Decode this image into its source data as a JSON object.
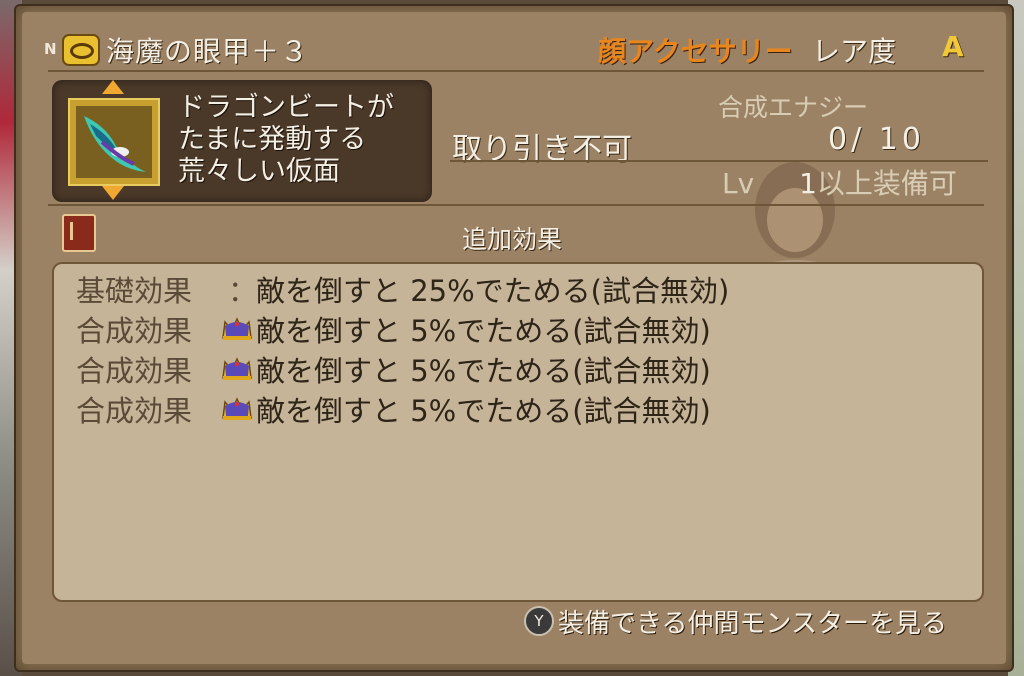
{
  "title_row": {
    "rank_tag": "N",
    "item_name": "海魔の眼甲＋３",
    "category": "顔アクセサリー",
    "rarity_label": "レア度",
    "rarity_value": "A"
  },
  "item": {
    "icon": "mask-icon",
    "description": [
      "ドラゴンビートが",
      "たまに発動する",
      "荒々しい仮面"
    ]
  },
  "info": {
    "energy_label": "合成エナジー",
    "trade_status": "取り引き不可",
    "energy_value": "0/ 10",
    "level_prefix": "Lv",
    "level_value": "1",
    "level_suffix": "以上装備可"
  },
  "effects": {
    "header": "追加効果",
    "rows": [
      {
        "label": "基礎効果",
        "sep": "：",
        "icon": "none",
        "text": "敵を倒すと 25%でためる(試合無効)"
      },
      {
        "label": "合成効果",
        "sep": "",
        "icon": "crown-icon",
        "text": "敵を倒すと 5%でためる(試合無効)"
      },
      {
        "label": "合成効果",
        "sep": "",
        "icon": "crown-icon",
        "text": "敵を倒すと 5%でためる(試合無効)"
      },
      {
        "label": "合成効果",
        "sep": "",
        "icon": "crown-icon",
        "text": "敵を倒すと 5%でためる(試合無効)"
      }
    ]
  },
  "footer": {
    "button_glyph": "Y",
    "text": "装備できる仲間モンスターを見る"
  },
  "colors": {
    "panel": "#9c8264",
    "category": "#e8861e",
    "rarity": "#f0c838",
    "effects_box": "#c6b498"
  }
}
